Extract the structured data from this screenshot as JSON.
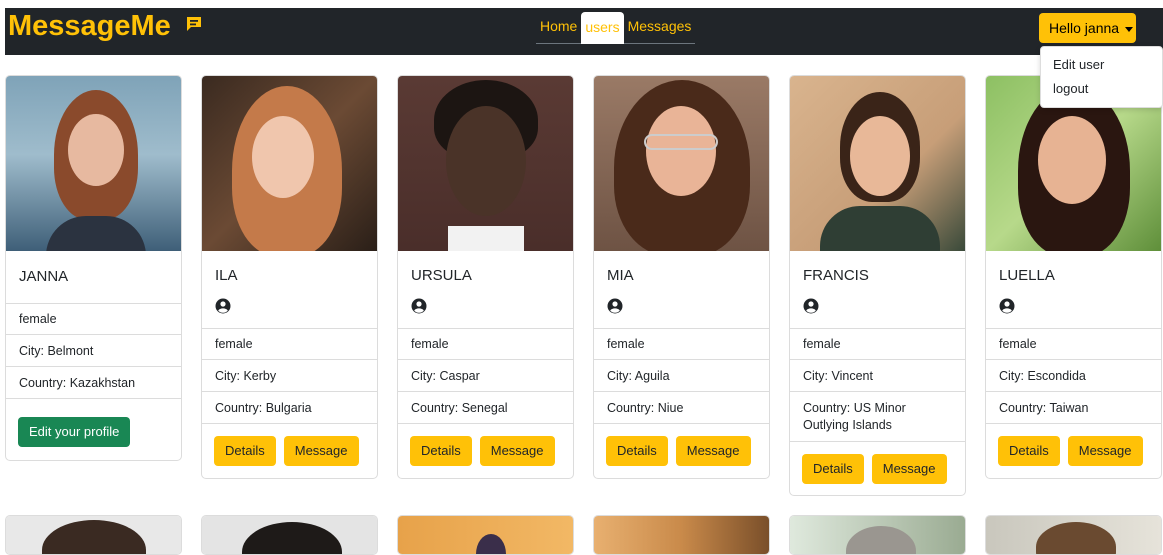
{
  "brand": {
    "title": "MessageMe",
    "color": "#ffc107"
  },
  "nav": {
    "links": [
      {
        "label": "Home",
        "active": false
      },
      {
        "label": "users",
        "active": true
      },
      {
        "label": "Messages",
        "active": false
      }
    ]
  },
  "user_menu": {
    "button_label": "Hello janna",
    "items": [
      "Edit user",
      "logout"
    ]
  },
  "current_user": {
    "name": "JANNA",
    "gender": "female",
    "city": "City: Belmont",
    "country": "Country: Kazakhstan",
    "edit_label": "Edit your profile"
  },
  "users": [
    {
      "name": "ILA",
      "gender": "female",
      "city": "City: Kerby",
      "country": "Country: Bulgaria"
    },
    {
      "name": "URSULA",
      "gender": "female",
      "city": "City: Caspar",
      "country": "Country: Senegal"
    },
    {
      "name": "MIA",
      "gender": "female",
      "city": "City: Aguila",
      "country": "Country: Niue"
    },
    {
      "name": "FRANCIS",
      "gender": "female",
      "city": "City: Vincent",
      "country": "Country: US Minor Outlying Islands"
    },
    {
      "name": "LUELLA",
      "gender": "female",
      "city": "City: Escondida",
      "country": "Country: Taiwan"
    }
  ],
  "card_actions": {
    "details": "Details",
    "message": "Message"
  },
  "colors": {
    "accent": "#ffc107",
    "navbar": "#212529",
    "success": "#198754"
  }
}
